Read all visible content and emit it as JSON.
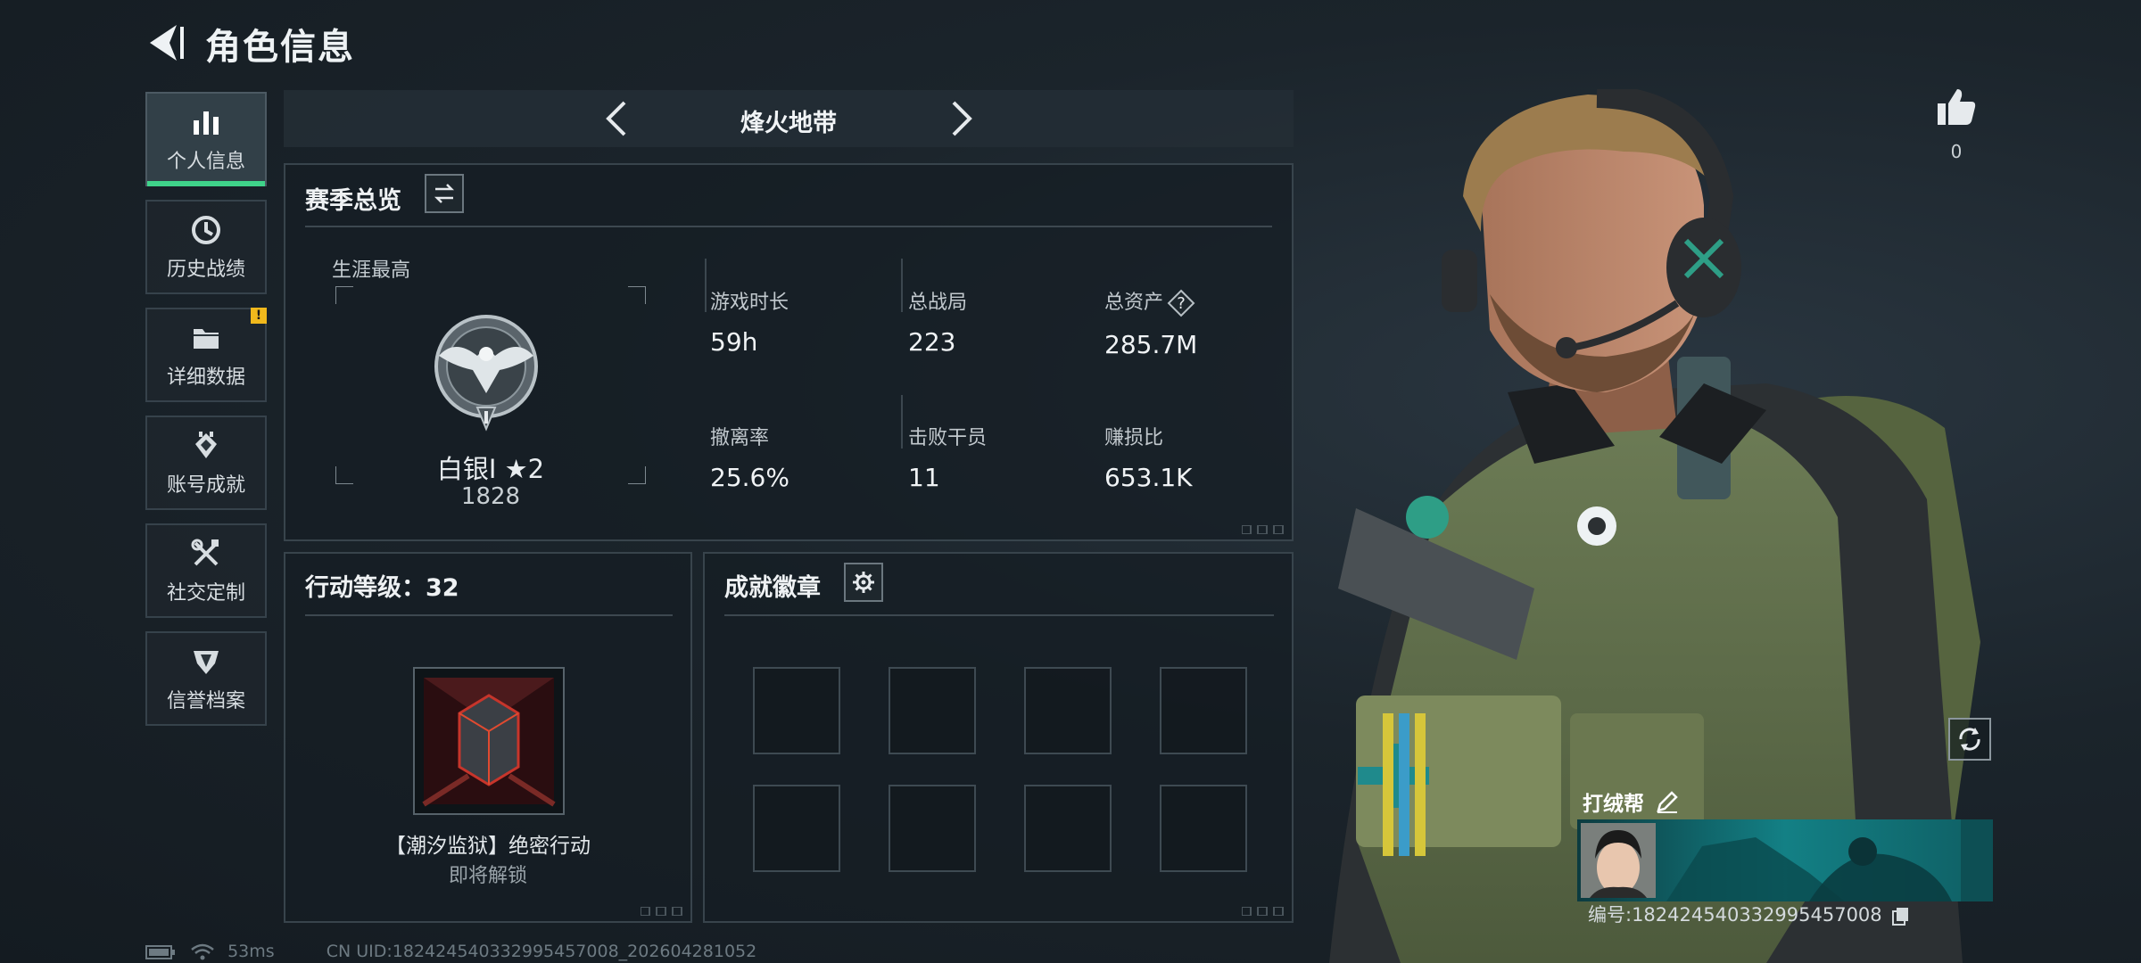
{
  "header": {
    "title": "角色信息"
  },
  "sidebar": {
    "items": [
      {
        "label": "个人信息",
        "icon": "bar-chart-icon",
        "active": true
      },
      {
        "label": "历史战绩",
        "icon": "clock-icon"
      },
      {
        "label": "详细数据",
        "icon": "folder-icon",
        "badge": "!"
      },
      {
        "label": "账号成就",
        "icon": "achievement-icon"
      },
      {
        "label": "社交定制",
        "icon": "tools-icon"
      },
      {
        "label": "信誉档案",
        "icon": "shield-icon"
      }
    ]
  },
  "mode": {
    "title": "烽火地带"
  },
  "season": {
    "title": "赛季总览",
    "career_label": "生涯最高",
    "rank_name": "白银I ★2",
    "rank_score": "1828",
    "stats": [
      {
        "label": "游戏时长",
        "value": "59h"
      },
      {
        "label": "总战局",
        "value": "223"
      },
      {
        "label": "总资产",
        "value": "285.7M"
      },
      {
        "label": "撤离率",
        "value": "25.6%"
      },
      {
        "label": "击败干员",
        "value": "11"
      },
      {
        "label": "赚损比",
        "value": "653.1K"
      }
    ]
  },
  "action": {
    "title": "行动等级：32",
    "operation_name": "【潮汐监狱】绝密行动",
    "operation_status": "即将解锁"
  },
  "achievements": {
    "title": "成就徽章",
    "slot_count": 8
  },
  "status": {
    "ping": "53ms",
    "uid": "CN UID:182424540332995457008_202604281052"
  },
  "profile": {
    "likes": "0",
    "name": "打绒帮",
    "id_text": "编号:182424540332995457008"
  },
  "colors": {
    "accent": "#3fd38a",
    "badge": "#f0b81c",
    "banner": "#138085"
  }
}
